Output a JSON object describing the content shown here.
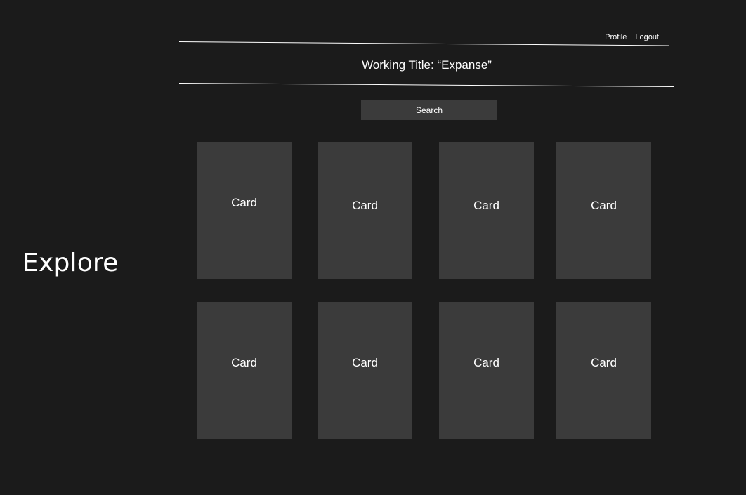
{
  "page_label": "Explore",
  "nav": {
    "profile_label": "Profile",
    "logout_label": "Logout"
  },
  "header": {
    "title": "Working Title: “Expanse”"
  },
  "search": {
    "label": "Search"
  },
  "cards": [
    {
      "label": "Card"
    },
    {
      "label": "Card"
    },
    {
      "label": "Card"
    },
    {
      "label": "Card"
    },
    {
      "label": "Card"
    },
    {
      "label": "Card"
    },
    {
      "label": "Card"
    },
    {
      "label": "Card"
    }
  ],
  "colors": {
    "background": "#1b1b1b",
    "card": "#3b3b3b",
    "text": "#ffffff",
    "rule": "#ffffff"
  }
}
